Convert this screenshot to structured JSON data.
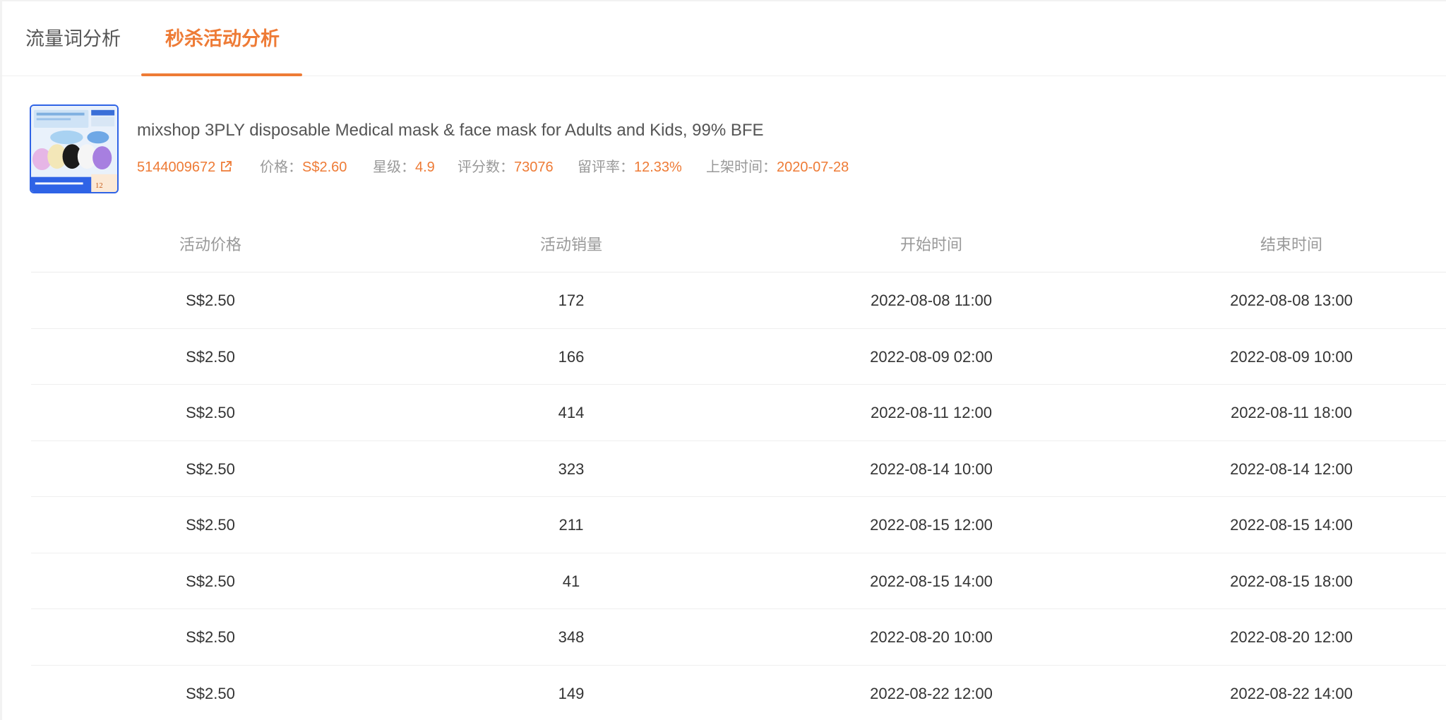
{
  "tabs": [
    {
      "label": "流量词分析",
      "active": false
    },
    {
      "label": "秒杀活动分析",
      "active": true
    }
  ],
  "product": {
    "title": "mixshop 3PLY disposable Medical mask & face mask for Adults and Kids, 99% BFE",
    "id": "5144009672",
    "price_label": "价格：",
    "price": "S$2.60",
    "rating_label": "星级：",
    "rating": "4.9",
    "reviews_label": "评分数：",
    "reviews": "73076",
    "review_rate_label": "留评率：",
    "review_rate": "12.33%",
    "listed_label": "上架时间：",
    "listed": "2020-07-28"
  },
  "table": {
    "headers": [
      "活动价格",
      "活动销量",
      "开始时间",
      "结束时间"
    ],
    "rows": [
      [
        "S$2.50",
        "172",
        "2022-08-08 11:00",
        "2022-08-08 13:00"
      ],
      [
        "S$2.50",
        "166",
        "2022-08-09 02:00",
        "2022-08-09 10:00"
      ],
      [
        "S$2.50",
        "414",
        "2022-08-11 12:00",
        "2022-08-11 18:00"
      ],
      [
        "S$2.50",
        "323",
        "2022-08-14 10:00",
        "2022-08-14 12:00"
      ],
      [
        "S$2.50",
        "211",
        "2022-08-15 12:00",
        "2022-08-15 14:00"
      ],
      [
        "S$2.50",
        "41",
        "2022-08-15 14:00",
        "2022-08-15 18:00"
      ],
      [
        "S$2.50",
        "348",
        "2022-08-20 10:00",
        "2022-08-20 12:00"
      ],
      [
        "S$2.50",
        "149",
        "2022-08-22 12:00",
        "2022-08-22 14:00"
      ]
    ]
  },
  "colors": {
    "accent": "#ee7b36",
    "muted": "#999999",
    "thumb_border": "#2f63e6"
  },
  "icons": {
    "external_link": "external-link-icon"
  }
}
